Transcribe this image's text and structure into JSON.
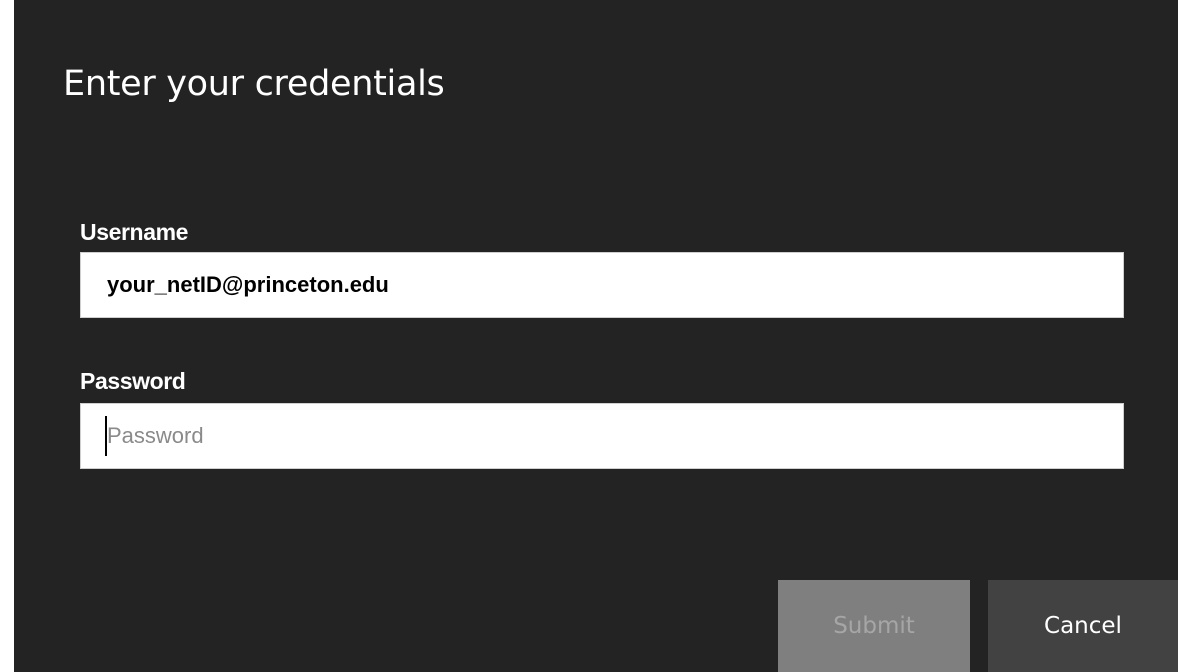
{
  "dialog": {
    "title": "Enter your credentials",
    "username": {
      "label": "Username",
      "value": "your_netID@princeton.edu"
    },
    "password": {
      "label": "Password",
      "value": "",
      "placeholder": "Password"
    },
    "buttons": {
      "submit_label": "Submit",
      "submit_state": "disabled",
      "cancel_label": "Cancel"
    }
  },
  "colors": {
    "dialog_background": "#232323",
    "input_background": "#ffffff",
    "submit_disabled": "#7f7f7f",
    "cancel_background": "#424242"
  }
}
